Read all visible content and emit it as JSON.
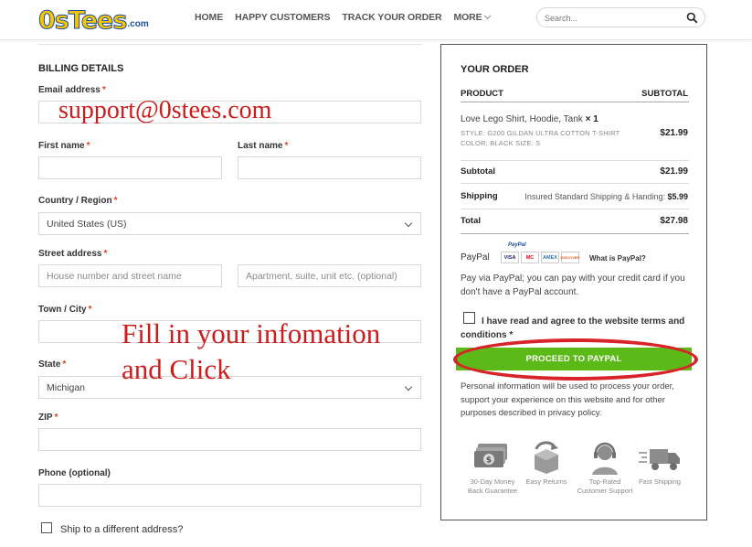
{
  "header": {
    "logo_main": "0sTees",
    "logo_com": ".com",
    "nav": [
      "HOME",
      "HAPPY CUSTOMERS",
      "TRACK YOUR ORDER",
      "MORE"
    ],
    "search_placeholder": "Search..."
  },
  "billing": {
    "title": "BILLING DETAILS",
    "required_mark": "*",
    "email_label": "Email address",
    "first_name_label": "First name",
    "last_name_label": "Last name",
    "country_label": "Country / Region",
    "country_value": "United States (US)",
    "street_label": "Street address",
    "street_placeholder": "House number and street name",
    "street2_placeholder": "Apartment, suite, unit etc. (optional)",
    "city_label": "Town / City",
    "state_label": "State",
    "state_value": "Michigan",
    "zip_label": "ZIP",
    "phone_label": "Phone (optional)",
    "ship_different_label": "Ship to a different address?"
  },
  "annotations": {
    "email_overlay": "support@0stees.com",
    "fill_line1": "Fill in your infomation",
    "fill_line2": "and Click"
  },
  "order": {
    "title": "YOUR ORDER",
    "col_product": "PRODUCT",
    "col_subtotal": "SUBTOTAL",
    "product_name": "Love Lego Shirt, Hoodie, Tank",
    "product_qty": "× 1",
    "product_style": "STYLE:  G200 GILDAN ULTRA COTTON T-SHIRT",
    "product_color_size": "COLOR:  BLACK   SIZE:  S",
    "product_price": "$21.99",
    "subtotal_label": "Subtotal",
    "subtotal_value": "$21.99",
    "shipping_label": "Shipping",
    "shipping_method": "Insured Standard Shipping & Handing:",
    "shipping_value": "$5.99",
    "total_label": "Total",
    "total_value": "$27.98",
    "paypal_label": "PayPal",
    "paypal_mini": "PayPal",
    "cards": [
      "VISA",
      "MC",
      "AMEX",
      "DISCOVER"
    ],
    "what_is_paypal": "What is PayPal?",
    "paypal_desc": "Pay via PayPal; you can pay with your credit card if you don't have a PayPal account.",
    "terms_text": "I have read and agree to the website terms and conditions *",
    "pay_button": "PROCEED TO PAYPAL",
    "privacy_text": "Personal information will be used to process your order, support your experience on this website and for other purposes described in privacy policy.",
    "badges": [
      {
        "line1": "30-Day Money",
        "line2": "Back Guarantee",
        "icon": "money-icon"
      },
      {
        "line1": "Easy Returns",
        "line2": "",
        "icon": "box-return-icon"
      },
      {
        "line1": "Top-Rated",
        "line2": "Customer Support",
        "icon": "support-headset-icon"
      },
      {
        "line1": "Fast Shipping",
        "line2": "",
        "icon": "truck-icon"
      }
    ],
    "accent_green": "#5cba18",
    "annotation_red": "#cc1c1c"
  }
}
